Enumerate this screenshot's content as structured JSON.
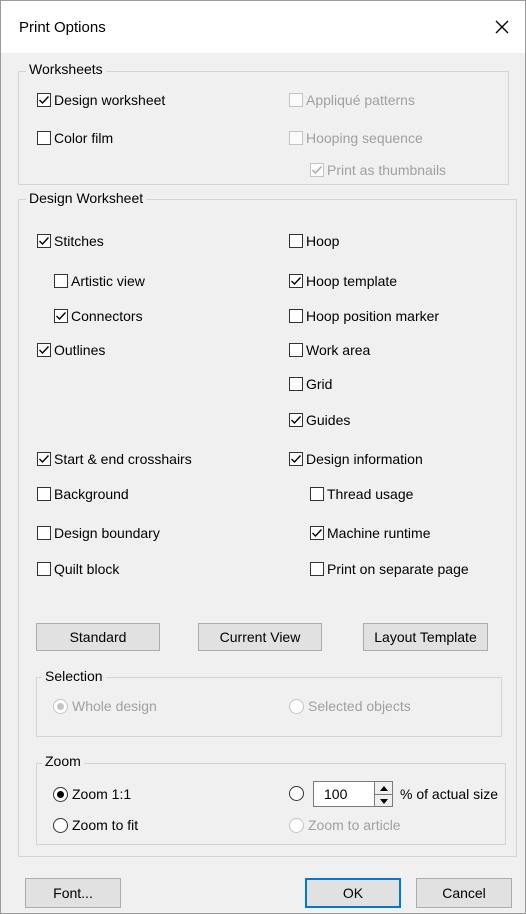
{
  "window": {
    "title": "Print Options"
  },
  "worksheets": {
    "legend": "Worksheets",
    "design_worksheet": {
      "label": "Design worksheet",
      "checked": true
    },
    "color_film": {
      "label": "Color film",
      "checked": false
    },
    "applique_patterns": {
      "label": "Appliqué patterns",
      "checked": false,
      "disabled": true
    },
    "hooping_sequence": {
      "label": "Hooping sequence",
      "checked": false,
      "disabled": true
    },
    "print_as_thumbnails": {
      "label": "Print as thumbnails",
      "checked": true,
      "disabled": true
    }
  },
  "design_worksheet": {
    "legend": "Design Worksheet",
    "stitches": {
      "label": "Stitches",
      "checked": true
    },
    "artistic_view": {
      "label": "Artistic view",
      "checked": false
    },
    "connectors": {
      "label": "Connectors",
      "checked": true
    },
    "outlines": {
      "label": "Outlines",
      "checked": true
    },
    "hoop": {
      "label": "Hoop",
      "checked": false
    },
    "hoop_template": {
      "label": "Hoop template",
      "checked": true
    },
    "hoop_position_marker": {
      "label": "Hoop position marker",
      "checked": false
    },
    "work_area": {
      "label": "Work area",
      "checked": false
    },
    "grid": {
      "label": "Grid",
      "checked": false
    },
    "guides": {
      "label": "Guides",
      "checked": true
    },
    "start_end_crosshairs": {
      "label": "Start & end crosshairs",
      "checked": true
    },
    "background": {
      "label": "Background",
      "checked": false
    },
    "design_boundary": {
      "label": "Design boundary",
      "checked": false
    },
    "quilt_block": {
      "label": "Quilt block",
      "checked": false
    },
    "design_information": {
      "label": "Design information",
      "checked": true
    },
    "thread_usage": {
      "label": "Thread usage",
      "checked": false
    },
    "machine_runtime": {
      "label": "Machine runtime",
      "checked": true
    },
    "print_on_separate_page": {
      "label": "Print on separate page",
      "checked": false
    },
    "buttons": {
      "standard": "Standard",
      "current_view": "Current View",
      "layout_template": "Layout Template"
    },
    "selection": {
      "legend": "Selection",
      "whole_design": {
        "label": "Whole design",
        "selected": true,
        "disabled": true
      },
      "selected_objects": {
        "label": "Selected objects",
        "selected": false,
        "disabled": true
      }
    },
    "zoom": {
      "legend": "Zoom",
      "zoom_1_1": {
        "label": "Zoom 1:1",
        "selected": true
      },
      "zoom_to_fit": {
        "label": "Zoom to fit",
        "selected": false
      },
      "percent": {
        "selected": false,
        "value": "100",
        "suffix": "% of actual size"
      },
      "zoom_to_article": {
        "label": "Zoom to article",
        "selected": false,
        "disabled": true
      }
    }
  },
  "footer": {
    "font": "Font...",
    "ok": "OK",
    "cancel": "Cancel"
  },
  "icons": {
    "close": "close-icon",
    "check": "checkmark-icon",
    "spin_up": "spin-up-icon",
    "spin_down": "spin-down-icon"
  }
}
